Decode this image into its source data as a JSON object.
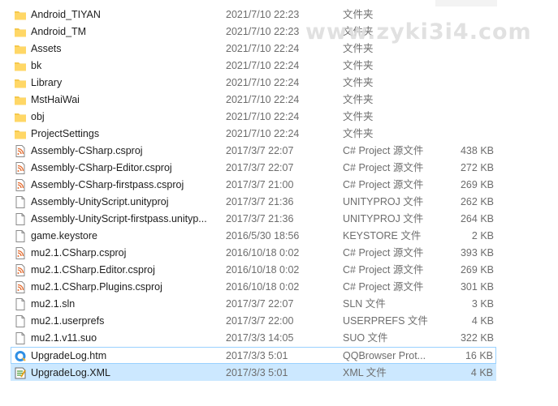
{
  "files": [
    {
      "name": "Android_TIYAN",
      "date": "2021/7/10 22:23",
      "type": "文件夹",
      "size": "",
      "icon": "folder-icon"
    },
    {
      "name": "Android_TM",
      "date": "2021/7/10 22:23",
      "type": "文件夹",
      "size": "",
      "icon": "folder-icon"
    },
    {
      "name": "Assets",
      "date": "2021/7/10 22:24",
      "type": "文件夹",
      "size": "",
      "icon": "folder-icon"
    },
    {
      "name": "bk",
      "date": "2021/7/10 22:24",
      "type": "文件夹",
      "size": "",
      "icon": "folder-icon"
    },
    {
      "name": "Library",
      "date": "2021/7/10 22:24",
      "type": "文件夹",
      "size": "",
      "icon": "folder-icon"
    },
    {
      "name": "MstHaiWai",
      "date": "2021/7/10 22:24",
      "type": "文件夹",
      "size": "",
      "icon": "folder-icon"
    },
    {
      "name": "obj",
      "date": "2021/7/10 22:24",
      "type": "文件夹",
      "size": "",
      "icon": "folder-icon"
    },
    {
      "name": "ProjectSettings",
      "date": "2021/7/10 22:24",
      "type": "文件夹",
      "size": "",
      "icon": "folder-icon"
    },
    {
      "name": "Assembly-CSharp.csproj",
      "date": "2017/3/7 22:07",
      "type": "C# Project 源文件",
      "size": "438 KB",
      "icon": "csproj-file-icon"
    },
    {
      "name": "Assembly-CSharp-Editor.csproj",
      "date": "2017/3/7 22:07",
      "type": "C# Project 源文件",
      "size": "272 KB",
      "icon": "csproj-file-icon"
    },
    {
      "name": "Assembly-CSharp-firstpass.csproj",
      "date": "2017/3/7 21:00",
      "type": "C# Project 源文件",
      "size": "269 KB",
      "icon": "csproj-file-icon"
    },
    {
      "name": "Assembly-UnityScript.unityproj",
      "date": "2017/3/7 21:36",
      "type": "UNITYPROJ 文件",
      "size": "262 KB",
      "icon": "blank-file-icon"
    },
    {
      "name": "Assembly-UnityScript-firstpass.unityp...",
      "date": "2017/3/7 21:36",
      "type": "UNITYPROJ 文件",
      "size": "264 KB",
      "icon": "blank-file-icon"
    },
    {
      "name": "game.keystore",
      "date": "2016/5/30 18:56",
      "type": "KEYSTORE 文件",
      "size": "2 KB",
      "icon": "blank-file-icon"
    },
    {
      "name": "mu2.1.CSharp.csproj",
      "date": "2016/10/18 0:02",
      "type": "C# Project 源文件",
      "size": "393 KB",
      "icon": "csproj-file-icon"
    },
    {
      "name": "mu2.1.CSharp.Editor.csproj",
      "date": "2016/10/18 0:02",
      "type": "C# Project 源文件",
      "size": "269 KB",
      "icon": "csproj-file-icon"
    },
    {
      "name": "mu2.1.CSharp.Plugins.csproj",
      "date": "2016/10/18 0:02",
      "type": "C# Project 源文件",
      "size": "301 KB",
      "icon": "csproj-file-icon"
    },
    {
      "name": "mu2.1.sln",
      "date": "2017/3/7 22:07",
      "type": "SLN 文件",
      "size": "3 KB",
      "icon": "blank-file-icon"
    },
    {
      "name": "mu2.1.userprefs",
      "date": "2017/3/7 22:00",
      "type": "USERPREFS 文件",
      "size": "4 KB",
      "icon": "blank-file-icon"
    },
    {
      "name": "mu2.1.v11.suo",
      "date": "2017/3/3 14:05",
      "type": "SUO 文件",
      "size": "322 KB",
      "icon": "blank-file-icon"
    },
    {
      "name": "UpgradeLog.htm",
      "date": "2017/3/3 5:01",
      "type": "QQBrowser Prot...",
      "size": "16 KB",
      "icon": "qqbrowser-icon"
    },
    {
      "name": "UpgradeLog.XML",
      "date": "2017/3/3 5:01",
      "type": "XML 文件",
      "size": "4 KB",
      "icon": "xml-file-icon"
    }
  ],
  "watermark": "www.zyki3i4.com",
  "colors": {
    "folder": "#f5c84c",
    "hover_row": "#e5f3ff",
    "selected_row": "#cce8ff",
    "outline": "#99d1ff",
    "muted_text": "#6d6d6d"
  }
}
